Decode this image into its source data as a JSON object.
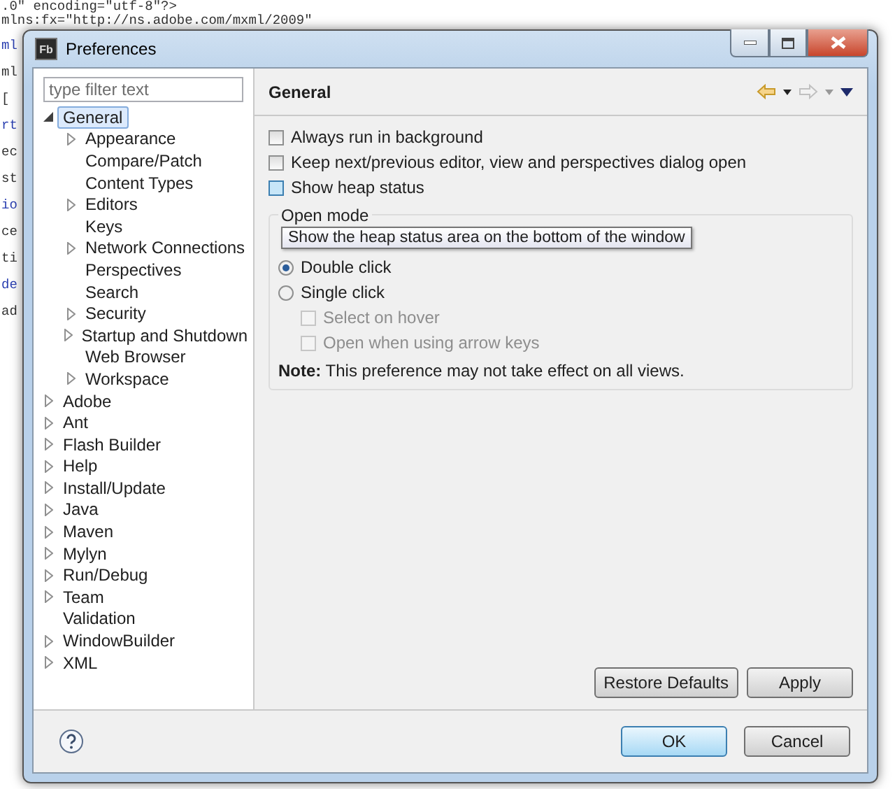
{
  "editor": {
    "lines": [
      ".0\" encoding=\"utf-8\"?>",
      "mlns:fx=\"http://ns.adobe.com/mxml/2009\""
    ],
    "fragments": [
      "ml",
      "ml",
      "[",
      "rt",
      "ec",
      "st",
      "io",
      "ce",
      "ti",
      "de",
      "ad"
    ]
  },
  "window": {
    "title": "Preferences",
    "icon_text": "Fb"
  },
  "filter": {
    "placeholder": "type filter text"
  },
  "tree": [
    {
      "label": "General",
      "kind": "node",
      "expanded": true,
      "selected": true,
      "children": [
        {
          "label": "Appearance",
          "kind": "node",
          "expanded": false,
          "selected": false
        },
        {
          "label": "Compare/Patch",
          "kind": "leaf",
          "selected": false
        },
        {
          "label": "Content Types",
          "kind": "leaf",
          "selected": false
        },
        {
          "label": "Editors",
          "kind": "node",
          "expanded": false,
          "selected": false
        },
        {
          "label": "Keys",
          "kind": "leaf",
          "selected": false
        },
        {
          "label": "Network Connections",
          "kind": "node",
          "expanded": false,
          "selected": false
        },
        {
          "label": "Perspectives",
          "kind": "leaf",
          "selected": false
        },
        {
          "label": "Search",
          "kind": "leaf",
          "selected": false
        },
        {
          "label": "Security",
          "kind": "node",
          "expanded": false,
          "selected": false
        },
        {
          "label": "Startup and Shutdown",
          "kind": "node",
          "expanded": false,
          "selected": false
        },
        {
          "label": "Web Browser",
          "kind": "leaf",
          "selected": false
        },
        {
          "label": "Workspace",
          "kind": "node",
          "expanded": false,
          "selected": false
        }
      ]
    },
    {
      "label": "Adobe",
      "kind": "node",
      "expanded": false,
      "selected": false
    },
    {
      "label": "Ant",
      "kind": "node",
      "expanded": false,
      "selected": false
    },
    {
      "label": "Flash Builder",
      "kind": "node",
      "expanded": false,
      "selected": false
    },
    {
      "label": "Help",
      "kind": "node",
      "expanded": false,
      "selected": false
    },
    {
      "label": "Install/Update",
      "kind": "node",
      "expanded": false,
      "selected": false
    },
    {
      "label": "Java",
      "kind": "node",
      "expanded": false,
      "selected": false
    },
    {
      "label": "Maven",
      "kind": "node",
      "expanded": false,
      "selected": false
    },
    {
      "label": "Mylyn",
      "kind": "node",
      "expanded": false,
      "selected": false
    },
    {
      "label": "Run/Debug",
      "kind": "node",
      "expanded": false,
      "selected": false
    },
    {
      "label": "Team",
      "kind": "node",
      "expanded": false,
      "selected": false
    },
    {
      "label": "Validation",
      "kind": "leaf",
      "selected": false
    },
    {
      "label": "WindowBuilder",
      "kind": "node",
      "expanded": false,
      "selected": false
    },
    {
      "label": "XML",
      "kind": "node",
      "expanded": false,
      "selected": false
    }
  ],
  "page": {
    "title": "General",
    "options": [
      {
        "label": "Always run in background",
        "checked": false,
        "hovered": false
      },
      {
        "label": "Keep next/previous editor, view and perspectives dialog open",
        "checked": false,
        "hovered": false
      },
      {
        "label": "Show heap status",
        "checked": false,
        "hovered": true
      }
    ],
    "tooltip": "Show the heap status area on the bottom of the window",
    "open_mode": {
      "legend": "Open mode",
      "radios": [
        {
          "label": "Double click",
          "selected": true
        },
        {
          "label": "Single click",
          "selected": false
        }
      ],
      "suboptions": [
        {
          "label": "Select on hover",
          "checked": false,
          "disabled": true
        },
        {
          "label": "Open when using arrow keys",
          "checked": false,
          "disabled": true
        }
      ]
    },
    "note": "**Note:** This preference may not take effect on all views.",
    "page_buttons": [
      "Restore Defaults",
      "Apply"
    ]
  },
  "buttons": [
    {
      "label": "OK",
      "default": true
    },
    {
      "label": "Cancel",
      "default": false
    }
  ]
}
